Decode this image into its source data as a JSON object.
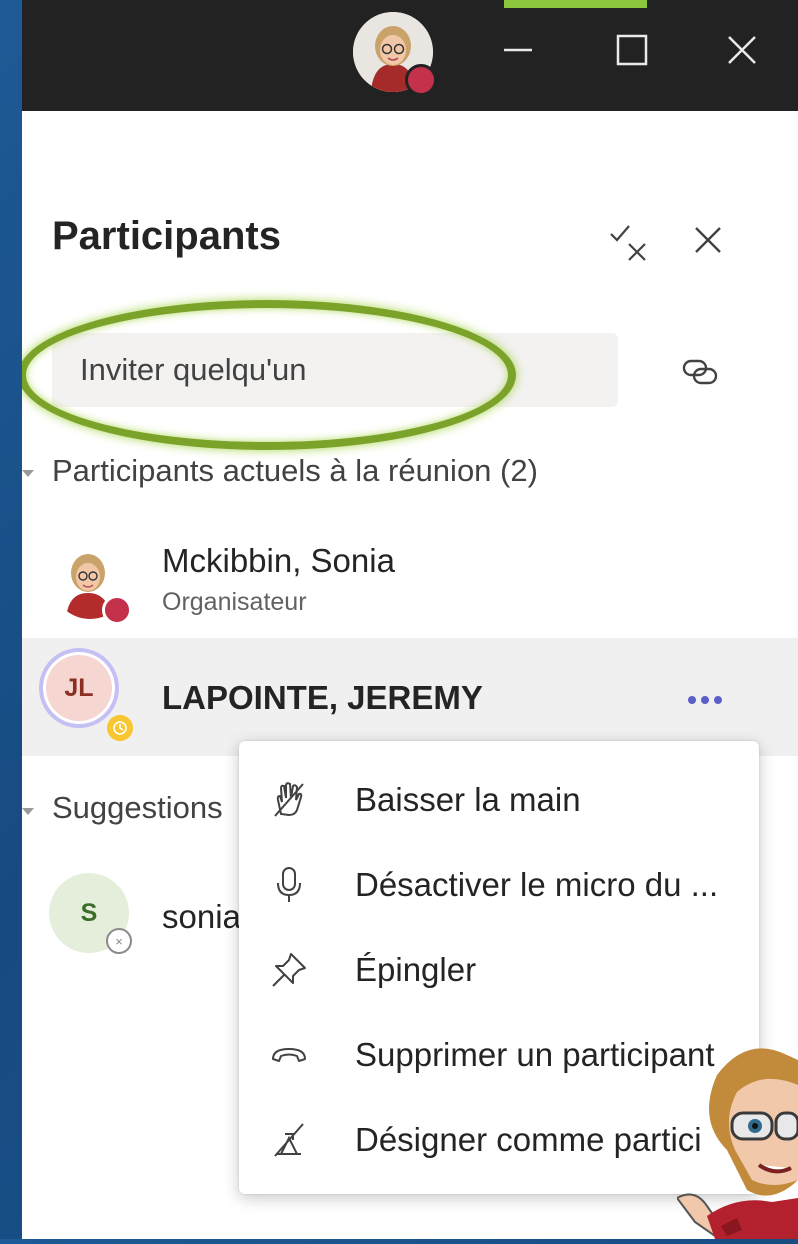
{
  "window": {
    "title_bar": {
      "minimize_icon": "minimize-icon",
      "maximize_icon": "maximize-icon",
      "close_icon": "close-icon"
    }
  },
  "panel": {
    "title": "Participants",
    "mute_all_icon": "check-x-icon",
    "close_icon": "close-icon",
    "invite": {
      "placeholder": "Inviter quelqu'un",
      "value": ""
    },
    "share_link_icon": "link-icon"
  },
  "current_section": {
    "title": "Participants actuels à la réunion (2)",
    "participants": [
      {
        "name": "Mckibbin, Sonia",
        "role": "Organisateur",
        "status": "busy"
      },
      {
        "name": "LAPOINTE, JEREMY",
        "initials": "JL",
        "status": "away"
      }
    ]
  },
  "suggestions_section": {
    "title": "Suggestions",
    "items": [
      {
        "initials": "S",
        "name": "sonia"
      }
    ]
  },
  "context_menu": {
    "items": [
      {
        "label": "Baisser la main",
        "icon": "lower-hand-icon"
      },
      {
        "label": "Désactiver le micro du ...",
        "icon": "microphone-icon"
      },
      {
        "label": "Épingler",
        "icon": "pin-icon"
      },
      {
        "label": "Supprimer un participant",
        "icon": "hang-up-icon"
      },
      {
        "label": "Désigner comme partici",
        "icon": "designate-attendee-icon"
      }
    ]
  },
  "colors": {
    "accent": "#5b5fc7",
    "highlight_ring": "#7ba32a",
    "busy": "#c4314b",
    "away": "#f8c630"
  }
}
